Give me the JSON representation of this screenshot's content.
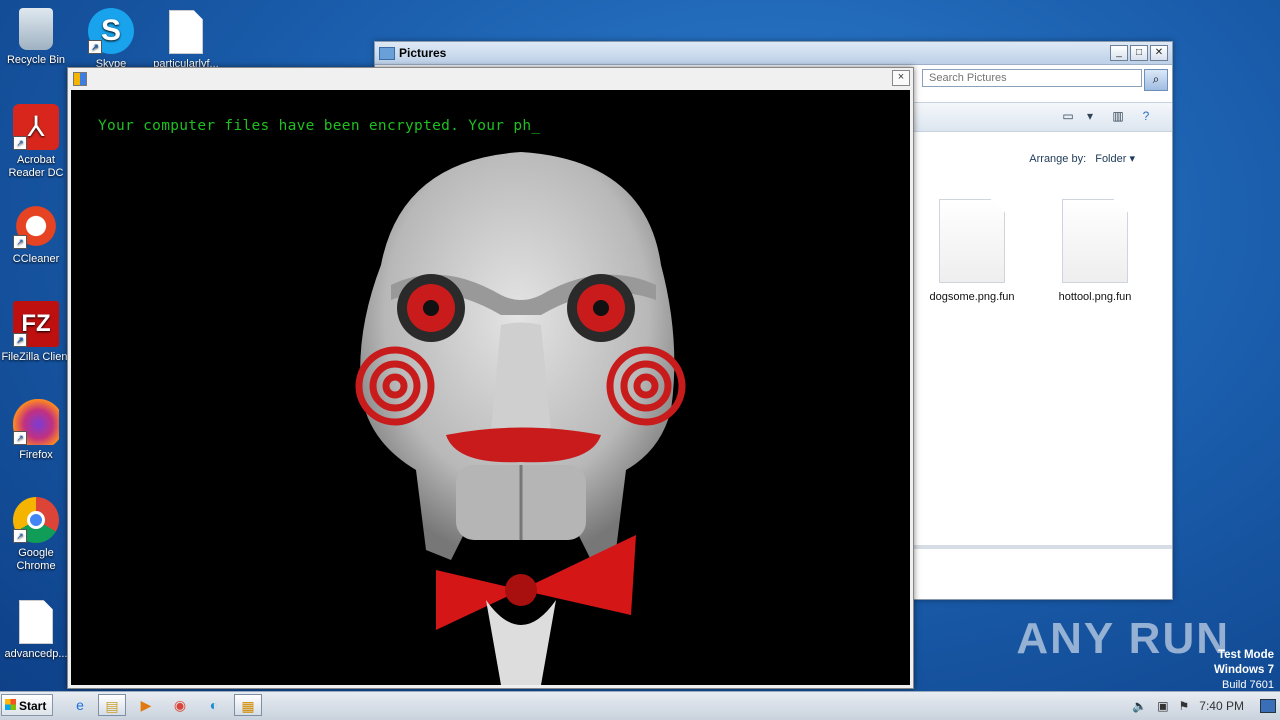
{
  "desktop": {
    "icons": [
      {
        "label": "Recycle Bin",
        "icon": "recycle-bin-icon"
      },
      {
        "label": "Skype",
        "icon": "skype-icon"
      },
      {
        "label": "particularlyf...",
        "icon": "document-icon"
      },
      {
        "label": "Acrobat Reader DC",
        "icon": "acrobat-icon"
      },
      {
        "label": "CCleaner",
        "icon": "ccleaner-icon"
      },
      {
        "label": "FileZilla Client",
        "icon": "filezilla-icon"
      },
      {
        "label": "Firefox",
        "icon": "firefox-icon"
      },
      {
        "label": "Google Chrome",
        "icon": "chrome-icon"
      },
      {
        "label": "advancedp...",
        "icon": "document-icon"
      }
    ]
  },
  "explorer": {
    "title": "Pictures",
    "search_placeholder": "Search Pictures",
    "arrange_label": "Arrange by:",
    "arrange_value": "Folder",
    "files": [
      {
        "name": "dogsome.png.fun"
      },
      {
        "name": "hottool.png.fun"
      }
    ]
  },
  "ransom_window": {
    "message": "Your computer files have been encrypted. Your ph_",
    "close_label": "×"
  },
  "watermark": {
    "brand": "ANY RUN",
    "test_mode": "Test Mode",
    "os": "Windows 7",
    "build": "Build 7601"
  },
  "taskbar": {
    "start_label": "Start",
    "clock": "7:40 PM"
  },
  "colors": {
    "terminal_text": "#1fbf1f",
    "desktop_bg": "#1b5fae"
  }
}
